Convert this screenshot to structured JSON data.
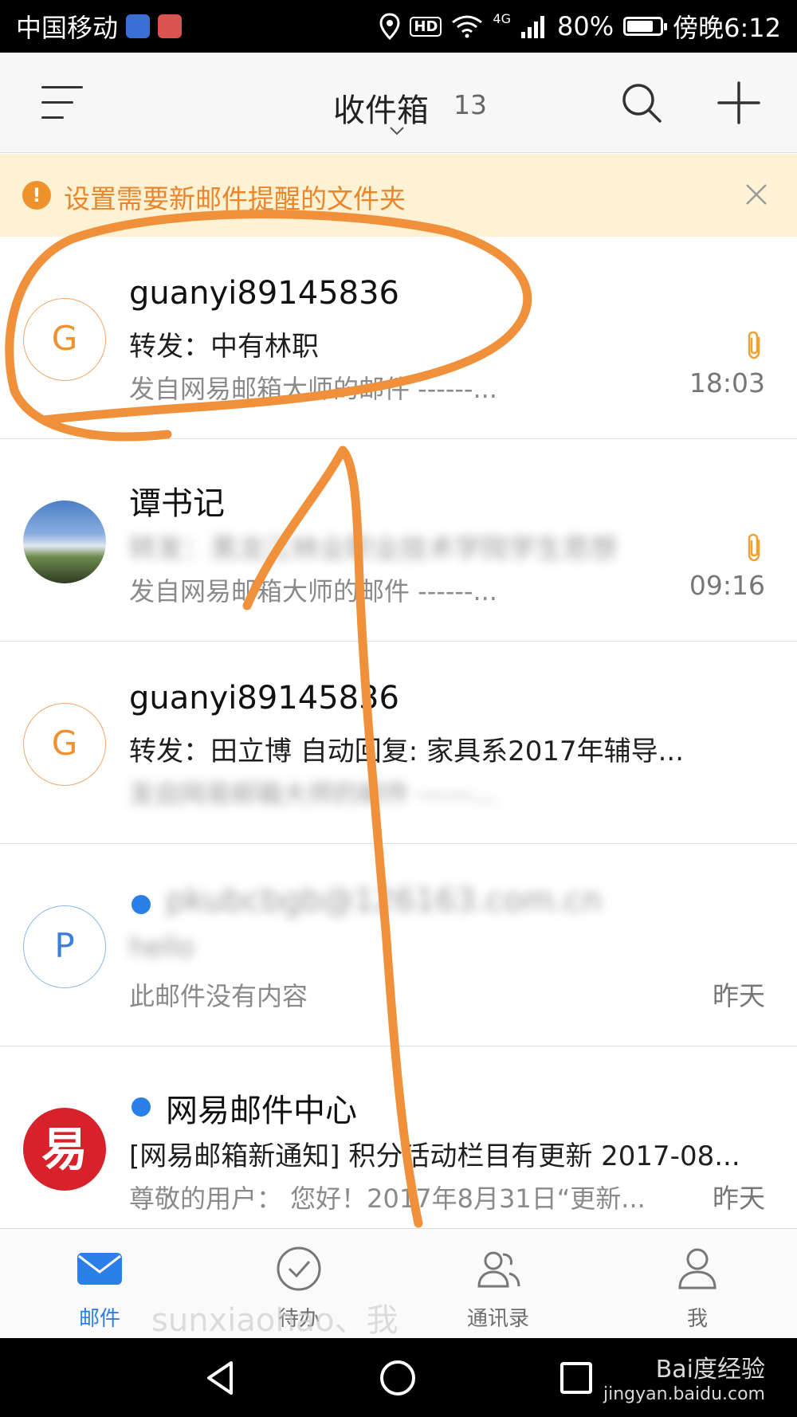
{
  "status_bar": {
    "carrier": "中国移动",
    "hd_label": "HD",
    "network": "4G",
    "battery_percent": "80%",
    "battery_level": 0.8,
    "time": "傍晚6:12"
  },
  "header": {
    "title": "收件箱",
    "unread_count": "13"
  },
  "banner": {
    "text": "设置需要新邮件提醒的文件夹",
    "icon_glyph": "!"
  },
  "mails": [
    {
      "avatar_letter": "G",
      "sender": "guanyi89145836",
      "subject": "转发：中有林职",
      "preview": "发自网易邮箱大师的邮件 ------...",
      "time": "18:03",
      "has_attachment": true,
      "unread": false
    },
    {
      "avatar_letter": "",
      "sender": "谭书记",
      "subject": "转发：黑龙江林业职业技术学院学生思想",
      "preview": "发自网易邮箱大师的邮件 ------...",
      "time": "09:16",
      "has_attachment": true,
      "unread": false
    },
    {
      "avatar_letter": "G",
      "sender": "guanyi89145836",
      "subject": "转发：田立博 自动回复: 家具系2017年辅导...",
      "preview": "发自网易邮箱大师的邮件 ------...",
      "time": "",
      "has_attachment": false,
      "unread": false
    },
    {
      "avatar_letter": "P",
      "sender": "pkubcbgb@126163.com.cn",
      "subject": "hello",
      "preview": "此邮件没有内容",
      "time": "昨天",
      "has_attachment": false,
      "unread": true
    },
    {
      "avatar_letter": "易",
      "sender": "网易邮件中心",
      "subject": "[网易邮箱新通知] 积分活动栏目有更新 2017-08...",
      "preview": "尊敬的用户： 您好！2017年8月31日“更新...",
      "time": "昨天",
      "has_attachment": false,
      "unread": true
    }
  ],
  "tabs": [
    {
      "label": "邮件",
      "active": true
    },
    {
      "label": "待办",
      "active": false
    },
    {
      "label": "通讯录",
      "active": false
    },
    {
      "label": "我",
      "active": false
    }
  ],
  "footer_overlay": "sunxiaohao、我",
  "watermark": {
    "brand": "Bai度经验",
    "url": "jingyan.baidu.com"
  },
  "colors": {
    "accent": "#2a7fe8",
    "banner_bg": "#fdf2d3",
    "banner_text": "#e9862c",
    "annotation": "#f0903a"
  }
}
